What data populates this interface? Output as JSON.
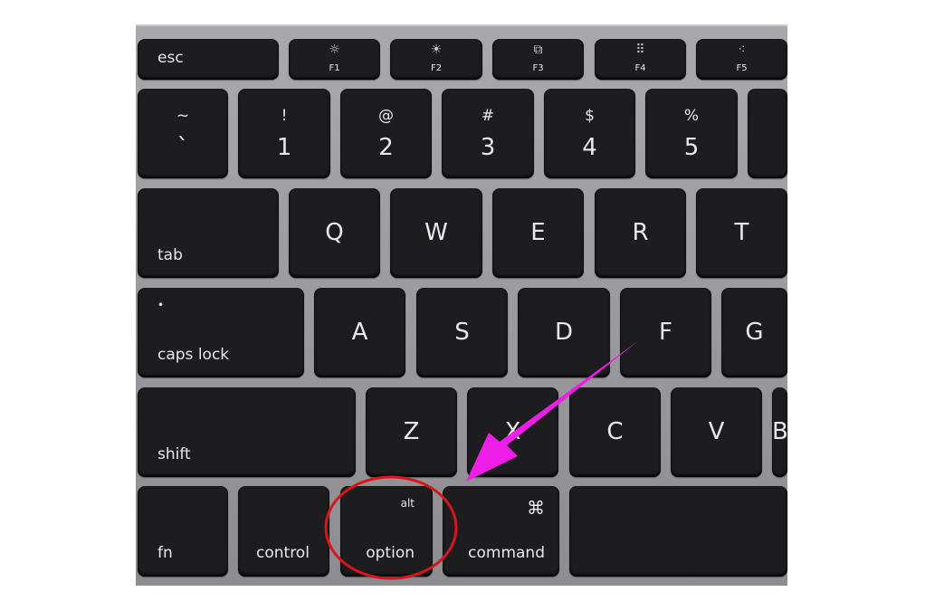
{
  "keyboard": {
    "function_row": [
      {
        "label": "esc"
      },
      {
        "label": "F1",
        "icon": "brightness-down-icon",
        "glyph": "☼"
      },
      {
        "label": "F2",
        "icon": "brightness-up-icon",
        "glyph": "☀"
      },
      {
        "label": "F3",
        "icon": "mission-control-icon",
        "glyph": "⧉"
      },
      {
        "label": "F4",
        "icon": "launchpad-icon",
        "glyph": "⠿"
      },
      {
        "label": "F5",
        "icon": "keyboard-backlight-down-icon",
        "glyph": "⁖"
      }
    ],
    "number_row": [
      {
        "top": "~",
        "bottom": "`"
      },
      {
        "top": "!",
        "bottom": "1"
      },
      {
        "top": "@",
        "bottom": "2"
      },
      {
        "top": "#",
        "bottom": "3"
      },
      {
        "top": "$",
        "bottom": "4"
      },
      {
        "top": "%",
        "bottom": "5"
      },
      {
        "top": "",
        "bottom": ""
      }
    ],
    "qwerty_row": [
      {
        "label": "tab"
      },
      {
        "label": "Q"
      },
      {
        "label": "W"
      },
      {
        "label": "E"
      },
      {
        "label": "R"
      },
      {
        "label": "T"
      }
    ],
    "home_row": [
      {
        "label": "caps lock",
        "indicator": "•"
      },
      {
        "label": "A"
      },
      {
        "label": "S"
      },
      {
        "label": "D"
      },
      {
        "label": "F"
      },
      {
        "label": "G"
      }
    ],
    "bottom_letter_row": [
      {
        "label": "shift"
      },
      {
        "label": "Z"
      },
      {
        "label": "X"
      },
      {
        "label": "C"
      },
      {
        "label": "V"
      },
      {
        "label": "B"
      }
    ],
    "modifier_row": [
      {
        "label": "fn"
      },
      {
        "label": "control"
      },
      {
        "label": "option",
        "top": "alt"
      },
      {
        "label": "command",
        "top": "⌘",
        "icon": "command-icon"
      },
      {
        "label": ""
      }
    ]
  },
  "annotations": {
    "highlight_color": "#d8141c",
    "arrow_color": "#ee1ee8",
    "highlighted_key": "option"
  }
}
